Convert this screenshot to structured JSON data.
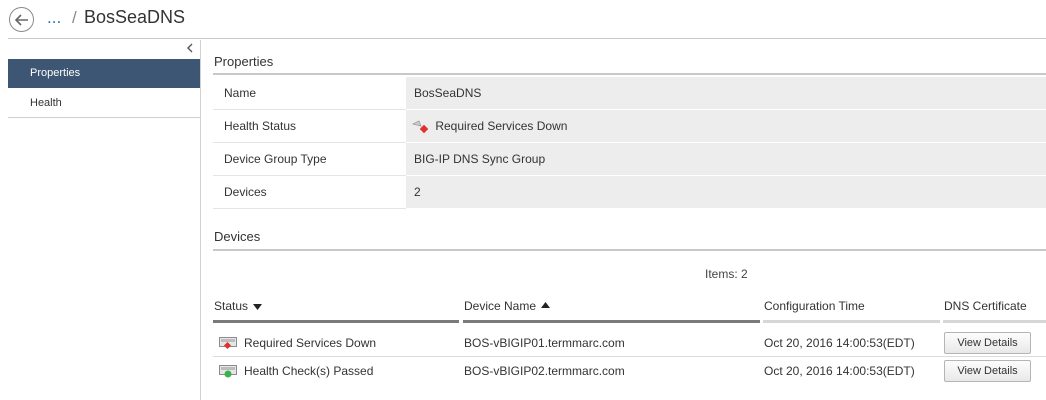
{
  "header": {
    "ellipsis": "...",
    "separator": "/",
    "title": "BosSeaDNS"
  },
  "nav": {
    "items": [
      {
        "label": "Properties",
        "active": true
      },
      {
        "label": "Health",
        "active": false
      }
    ]
  },
  "properties": {
    "title": "Properties",
    "rows": [
      {
        "label": "Name",
        "value": "BosSeaDNS"
      },
      {
        "label": "Health Status",
        "value": "Required Services Down",
        "icon": "required-services-down-icon"
      },
      {
        "label": "Device Group Type",
        "value": "BIG-IP DNS Sync Group"
      },
      {
        "label": "Devices",
        "value": "2"
      }
    ]
  },
  "devices": {
    "title": "Devices",
    "items_label": "Items: 2",
    "columns": [
      "Status",
      "Device Name",
      "Configuration Time",
      "DNS Certificate"
    ],
    "rows": [
      {
        "status": "Required Services Down",
        "status_icon": "red-diamond-status-icon",
        "device_name": "BOS-vBIGIP01.termmarc.com",
        "config_time": "Oct 20, 2016 14:00:53(EDT)",
        "action": "View Details"
      },
      {
        "status": "Health Check(s) Passed",
        "status_icon": "green-dot-status-icon",
        "device_name": "BOS-vBIGIP02.termmarc.com",
        "config_time": "Oct 20, 2016 14:00:53(EDT)",
        "action": "View Details"
      }
    ]
  },
  "colors": {
    "nav_active": "#3c5673",
    "link": "#2a6ebb",
    "status_down": "#e03131",
    "status_ok": "#3cb34a"
  }
}
